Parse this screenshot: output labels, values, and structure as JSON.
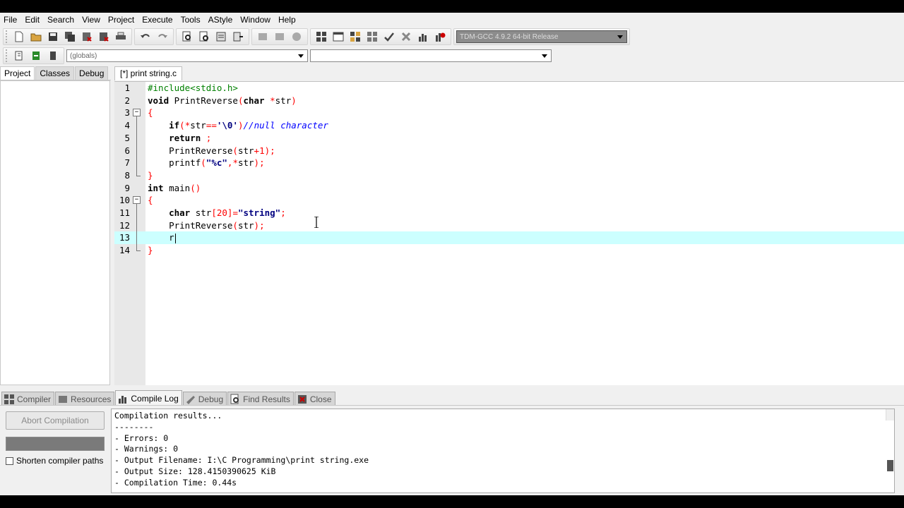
{
  "menu": [
    "File",
    "Edit",
    "Search",
    "View",
    "Project",
    "Execute",
    "Tools",
    "AStyle",
    "Window",
    "Help"
  ],
  "toolbar": {
    "compiler_select": "TDM-GCC 4.9.2 64-bit Release",
    "globals_select": "(globals)",
    "member_select": ""
  },
  "left_panel": {
    "tabs": [
      "Project",
      "Classes",
      "Debug"
    ]
  },
  "editor": {
    "tab_label": "[*] print string.c",
    "line_numbers": [
      "1",
      "2",
      "3",
      "4",
      "5",
      "6",
      "7",
      "8",
      "9",
      "10",
      "11",
      "12",
      "13",
      "14"
    ],
    "lines": [
      "#include<stdio.h>",
      "void PrintReverse(char *str)",
      "{",
      "    if(*str=='\\0')//null character",
      "    return ;",
      "    PrintReverse(str+1);",
      "    printf(\"%c\",*str);",
      "}",
      "int main()",
      "{",
      "    char str[20]=\"string\";",
      "    PrintReverse(str);",
      "    r",
      "}"
    ],
    "current_line": 13
  },
  "bottom_tabs": [
    "Compiler",
    "Resources",
    "Compile Log",
    "Debug",
    "Find Results",
    "Close"
  ],
  "bottom_panel": {
    "abort_label": "Abort Compilation",
    "shorten_label": "Shorten compiler paths",
    "log": [
      "Compilation results...",
      "--------",
      "- Errors: 0",
      "- Warnings: 0",
      "- Output Filename: I:\\C Programming\\print string.exe",
      "- Output Size: 128.4150390625 KiB",
      "- Compilation Time: 0.44s"
    ]
  },
  "colors": {
    "current_line": "#ccffff",
    "gutter": "#e8e8e8",
    "comment": "#0000ff",
    "preprocessor": "#008000"
  }
}
